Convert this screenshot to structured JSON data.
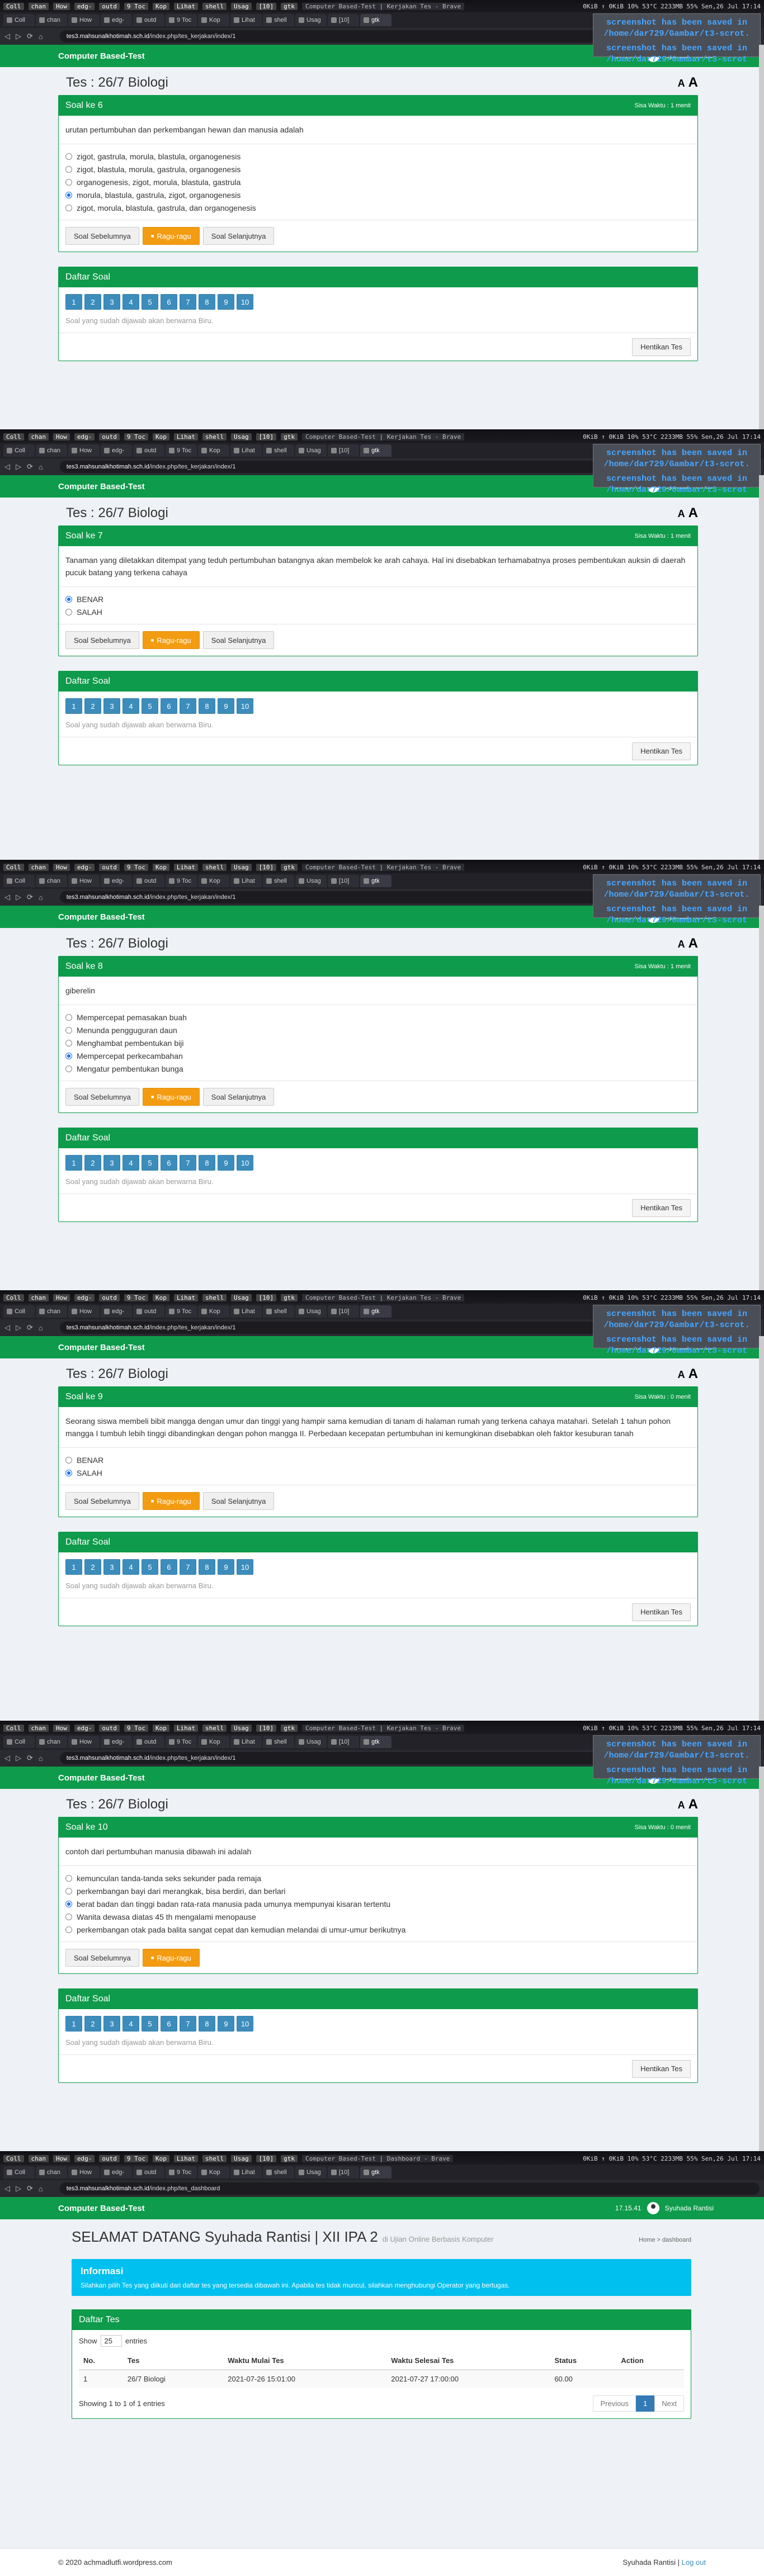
{
  "topbar": {
    "workspaces": [
      "Coll",
      "chan",
      "How",
      "edg-",
      "outd",
      "9 Toc",
      "Kop",
      "Lihat",
      "shell",
      "Usag",
      "[10]",
      "gtk"
    ],
    "title_quiz": "Computer Based-Test | Kerjakan Tes - Brave",
    "title_dash": "Computer Based-Test | Dashboard - Brave",
    "stats": "0KiB ↑ 0KiB  10% 53°C 2233MB  55%  Sen,26 Jul 17:14"
  },
  "browser": {
    "url_quiz_host": "tes3.mahsunalkhotimah.sch.id",
    "url_quiz_path": "/index.php/tes_kerjakan/index/1",
    "url_dash_host": "tes3.mahsunalkhotimah.sch.id",
    "url_dash_path": "/index.php/tes_dashboard"
  },
  "notification": {
    "line1": "screenshot has been saved in /home/dar729/Gambar/t3-scrot.",
    "line2": "screenshot has been saved in /home/dar729/Gambar/t3-scrot"
  },
  "app": {
    "brand": "Computer Based-Test",
    "clock": "17.15.41",
    "user": "Syuhada Rantisi"
  },
  "quiz": {
    "test_title": "Tes : 26/7 Biologi",
    "font_small": "A",
    "font_big": "A",
    "timer": "Sisa Waktu : 1 menit",
    "timer_zero": "Sisa Waktu : 0 menit",
    "prev": "Soal Sebelumnya",
    "doubt": "Ragu-ragu",
    "next": "Soal Selanjutnya",
    "list_title": "Daftar Soal",
    "list_note": "Soal yang sudah dijawab akan berwarna Biru.",
    "stop": "Hentikan Tes",
    "numbers": [
      "1",
      "2",
      "3",
      "4",
      "5",
      "6",
      "7",
      "8",
      "9",
      "10"
    ],
    "questions": [
      {
        "label": "Soal ke 6",
        "text": "urutan pertumbuhan dan perkembangan hewan dan manusia adalah",
        "options": [
          "zigot, gastrula, morula, blastula, organogenesis",
          "zigot, blastula, morula, gastrula, organogenesis",
          "organogenesis, zigot, morula, blastula, gastrula",
          "morula, blastula, gastrula, zigot, organogenesis",
          "zigot, morula, blastula, gastrula, dan organogenesis"
        ],
        "selected": 3
      },
      {
        "label": "Soal ke 7",
        "text": "Tanaman yang diletakkan ditempat yang teduh pertumbuhan batangnya akan membelok ke arah cahaya. Hal ini disebabkan terhamabatnya proses pembentukan auksin di daerah pucuk batang yang terkena cahaya",
        "options": [
          "BENAR",
          "SALAH"
        ],
        "selected": 0
      },
      {
        "label": "Soal ke 8",
        "text": "giberelin",
        "options": [
          "Mempercepat pemasakan buah",
          "Menunda pengguguran daun",
          "Menghambat pembentukan biji",
          "Mempercepat perkecambahan",
          "Mengatur pembentukan bunga"
        ],
        "selected": 3
      },
      {
        "label": "Soal ke 9",
        "text": "Seorang siswa membeli bibit mangga dengan umur dan tinggi yang hampir sama kemudian di tanam di halaman rumah yang terkena cahaya matahari. Setelah 1 tahun pohon mangga I tumbuh lebih tinggi dibandingkan dengan pohon mangga II. Perbedaan kecepatan pertumbuhan ini kemungkinan disebabkan oleh faktor kesuburan tanah",
        "options": [
          "BENAR",
          "SALAH"
        ],
        "selected": 1
      },
      {
        "label": "Soal ke 10",
        "text": "contoh dari pertumbuhan manusia dibawah ini adalah",
        "options": [
          "kemunculan tanda-tanda seks sekunder pada remaja",
          "perkembangan bayi dari merangkak, bisa berdiri, dan berlari",
          "berat badan dan tinggi badan rata-rata manusia pada umunya mempunyai kisaran tertentu",
          "Wanita dewasa diatas 45 th mengalami menopause",
          "perkembangan otak pada balita sangat cepat dan kemudian melandai di umur-umur berikutnya"
        ],
        "selected": 2
      }
    ]
  },
  "dashboard": {
    "welcome": "SELAMAT DATANG Syuhada Rantisi | XII IPA 2",
    "subtitle": "di Ujian Online Berbasis Komputer",
    "bc_home": "Home",
    "bc_current": "dashboard",
    "info_title": "Informasi",
    "info_text": "Silahkan pilih Tes yang diikuti dari daftar tes yang tersedia dibawah ini. Apabila tes tidak muncul, silahkan menghubungi Operator yang bertugas.",
    "table_title": "Daftar Tes",
    "show": "Show",
    "entries": "entries",
    "page_size": "25",
    "columns": [
      "No.",
      "Tes",
      "Waktu Mulai Tes",
      "Waktu Selesai Tes",
      "Status",
      "Action"
    ],
    "rows": [
      [
        "1",
        "26/7 Biologi",
        "2021-07-26 15:01:00",
        "2021-07-27 17:00:00",
        "60.00",
        ""
      ]
    ],
    "showing": "Showing 1 to 1 of 1 entries",
    "prev": "Previous",
    "page": "1",
    "next": "Next",
    "footer_left": "© 2020 achmadlutfi.wordpress.com",
    "footer_user": "Syuhada Rantisi",
    "footer_logout": "Log out"
  }
}
